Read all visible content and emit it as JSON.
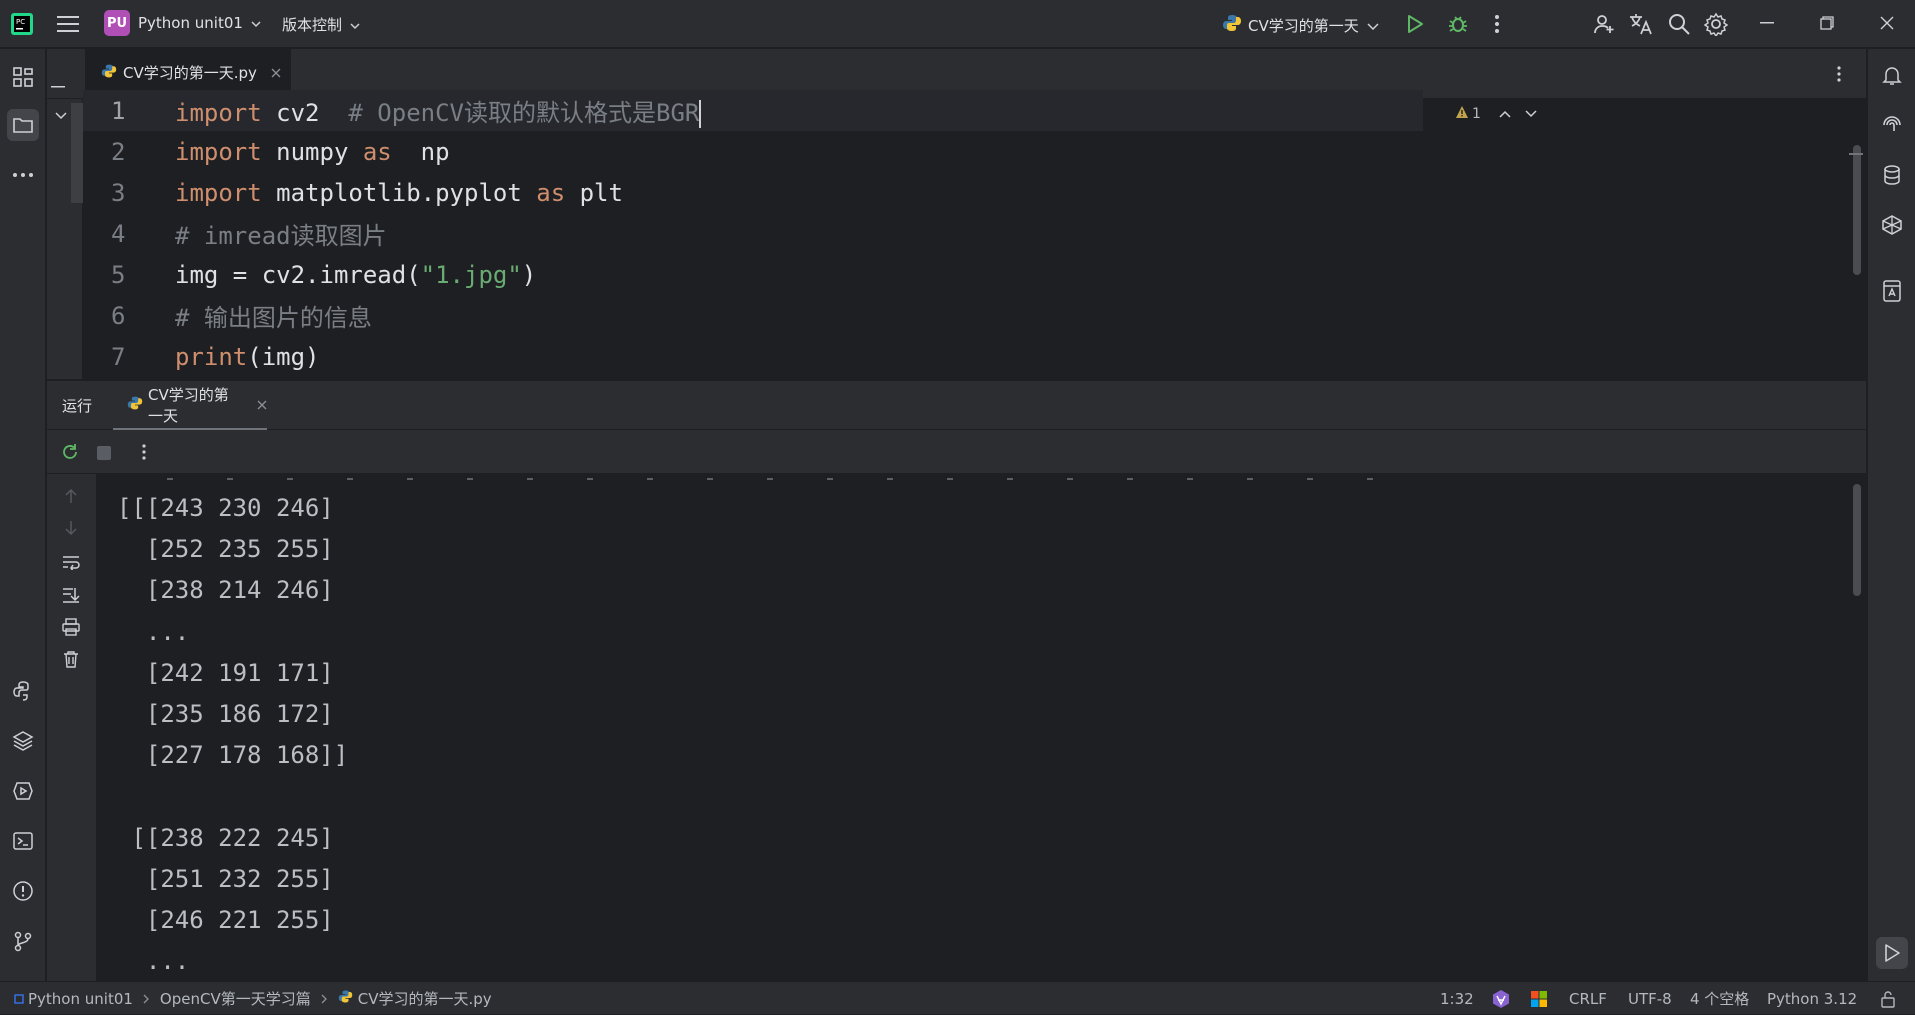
{
  "titlebar": {
    "project_badge": "PU",
    "project_name": "Python unit01",
    "vcs": "版本控制",
    "run_config": "CV学习的第一天"
  },
  "editor": {
    "tab_label": "CV学习的第一天.py",
    "inspection_count": "1",
    "lines": [
      {
        "n": "1",
        "parts": [
          [
            "kw",
            "import"
          ],
          [
            "fn",
            " cv2  "
          ],
          [
            "cm",
            "# OpenCV读取的默认格式是BGR"
          ]
        ]
      },
      {
        "n": "2",
        "parts": [
          [
            "kw",
            "import"
          ],
          [
            "fn",
            " numpy "
          ],
          [
            "kw",
            "as"
          ],
          [
            "fn",
            "  np"
          ]
        ]
      },
      {
        "n": "3",
        "parts": [
          [
            "kw",
            "import"
          ],
          [
            "fn",
            " matplotlib.pyplot "
          ],
          [
            "kw",
            "as"
          ],
          [
            "fn",
            " plt"
          ]
        ]
      },
      {
        "n": "4",
        "parts": [
          [
            "cm",
            "# imread读取图片"
          ]
        ]
      },
      {
        "n": "5",
        "parts": [
          [
            "fn",
            "img = cv2.imread("
          ],
          [
            "str",
            "\"1.jpg\""
          ],
          [
            "fn",
            ")"
          ]
        ]
      },
      {
        "n": "6",
        "parts": [
          [
            "cm",
            "# 输出图片的信息"
          ]
        ]
      },
      {
        "n": "7",
        "parts": [
          [
            "kw",
            "print"
          ],
          [
            "fn",
            "(img)"
          ]
        ]
      }
    ]
  },
  "run_panel": {
    "title": "运行",
    "tab_label": "CV学习的第一天"
  },
  "console": {
    "lines": [
      "[[[243 230 246]",
      "  [252 235 255]",
      "  [238 214 246]",
      "  ...",
      "  [242 191 171]",
      "  [235 186 172]",
      "  [227 178 168]]",
      "",
      " [[238 222 245]",
      "  [251 232 255]",
      "  [246 221 255]",
      "  ..."
    ]
  },
  "statusbar": {
    "crumb_project": "Python unit01",
    "crumb_folder": "OpenCV第一天学习篇",
    "crumb_file": "CV学习的第一天.py",
    "position": "1:32",
    "line_sep": "CRLF",
    "encoding": "UTF-8",
    "indent": "4 个空格",
    "interpreter": "Python 3.12"
  },
  "colors": {
    "accent": "#3574f0",
    "keyword": "#cf8e6d",
    "string": "#6aab73",
    "comment": "#7a7e85",
    "run_green": "#5fb865"
  }
}
